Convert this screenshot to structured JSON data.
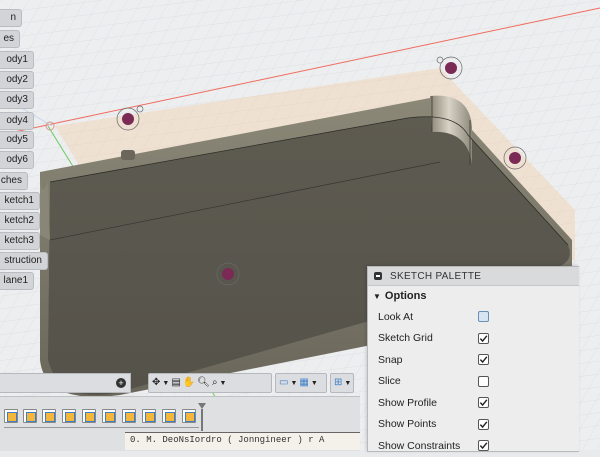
{
  "browser": {
    "items": [
      {
        "label": "n"
      },
      {
        "label": "es"
      },
      {
        "label": "ody1"
      },
      {
        "label": "ody2"
      },
      {
        "label": "ody3"
      },
      {
        "label": "ody4"
      },
      {
        "label": "ody5"
      },
      {
        "label": "ody6"
      },
      {
        "label": "ches"
      },
      {
        "label": "ketch1"
      },
      {
        "label": "ketch2"
      },
      {
        "label": "ketch3"
      },
      {
        "label": "struction"
      },
      {
        "label": "lane1"
      }
    ]
  },
  "sketch_palette": {
    "title": "SKETCH PALETTE",
    "section": "Options",
    "rows": [
      {
        "label": "Look At",
        "control": "look-at-icon"
      },
      {
        "label": "Sketch Grid",
        "checked": true
      },
      {
        "label": "Snap",
        "checked": true
      },
      {
        "label": "Slice",
        "checked": false
      },
      {
        "label": "Show Profile",
        "checked": true
      },
      {
        "label": "Show Points",
        "checked": true
      },
      {
        "label": "Show Constraints",
        "checked": true
      }
    ]
  },
  "navigation_bar": {
    "tools": [
      "orbit-icon",
      "look-at-icon",
      "pan-hand-icon",
      "zoom-icon",
      "zoom-window-icon",
      "display-settings-icon",
      "grid-settings-icon",
      "viewports-icon"
    ]
  },
  "timeline": {
    "features": [
      "sketch-feature",
      "extrude-feature",
      "sketch-feature",
      "extrude-feature",
      "fillet-feature",
      "shell-feature",
      "sketch-feature",
      "extrude-feature",
      "sketch-feature",
      "extrude-feature",
      "sketch-feature"
    ]
  },
  "document_strip": {
    "text": "0. M.  DeoNsIordro  ( Jonngineer )   r  A"
  },
  "colors": {
    "accent": "#f5a623",
    "model_body": "#5d5a4f",
    "background": "#e9eaec"
  }
}
